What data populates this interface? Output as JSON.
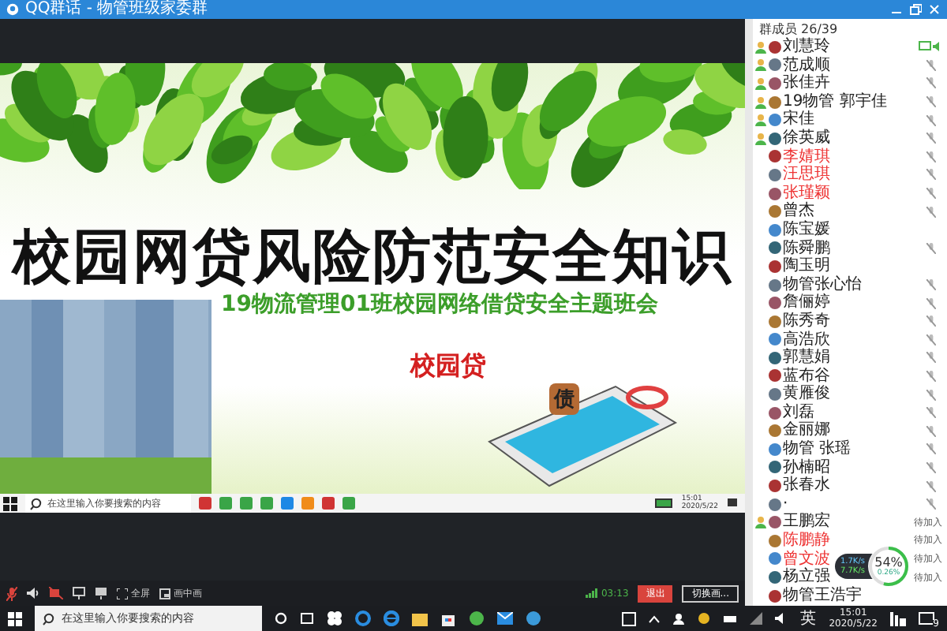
{
  "window": {
    "title": "QQ群话 - 物管班级家委群"
  },
  "slide": {
    "title": "校园网贷风险防范安全知识",
    "subtitle": "19物流管理01班校园网络借贷安全主题班会",
    "tag": "校园贷",
    "sign": "债"
  },
  "inner_taskbar": {
    "search_placeholder": "在这里输入你要搜索的内容",
    "time": "15:01",
    "date": "2020/5/22"
  },
  "call_controls": {
    "fullscreen": "全屏",
    "pip": "画中画",
    "duration": "03:13",
    "exit": "退出",
    "switch": "切换画..."
  },
  "members": {
    "header": "群成员 26/39",
    "items": [
      {
        "name": "刘慧玲",
        "role_icon": true,
        "highlighted": false,
        "kind": "speaking"
      },
      {
        "name": "范成顺",
        "role_icon": true,
        "highlighted": false,
        "kind": "muted"
      },
      {
        "name": "张佳卉",
        "role_icon": true,
        "highlighted": false,
        "kind": "muted"
      },
      {
        "name": "19物管 郭宇佳",
        "role_icon": true,
        "highlighted": false,
        "kind": "muted"
      },
      {
        "name": "宋佳",
        "role_icon": true,
        "highlighted": false,
        "kind": "muted"
      },
      {
        "name": "徐英威",
        "role_icon": true,
        "highlighted": false,
        "kind": "muted"
      },
      {
        "name": "李婧琪",
        "role_icon": false,
        "highlighted": true,
        "kind": "muted"
      },
      {
        "name": "汪思琪",
        "role_icon": false,
        "highlighted": true,
        "kind": "muted"
      },
      {
        "name": "张瑾颖",
        "role_icon": false,
        "highlighted": true,
        "kind": "muted"
      },
      {
        "name": "曾杰",
        "role_icon": false,
        "highlighted": false,
        "kind": "muted"
      },
      {
        "name": "陈宝媛",
        "role_icon": false,
        "highlighted": false,
        "kind": "none"
      },
      {
        "name": "陈舜鹏",
        "role_icon": false,
        "highlighted": false,
        "kind": "muted"
      },
      {
        "name": "陶玉明",
        "role_icon": false,
        "highlighted": false,
        "kind": "none"
      },
      {
        "name": "物管张心怡",
        "role_icon": false,
        "highlighted": false,
        "kind": "muted"
      },
      {
        "name": "詹俪婷",
        "role_icon": false,
        "highlighted": false,
        "kind": "muted"
      },
      {
        "name": "陈秀奇",
        "role_icon": false,
        "highlighted": false,
        "kind": "muted"
      },
      {
        "name": "高浩欣",
        "role_icon": false,
        "highlighted": false,
        "kind": "muted"
      },
      {
        "name": "郭慧娟",
        "role_icon": false,
        "highlighted": false,
        "kind": "muted"
      },
      {
        "name": "蓝布谷",
        "role_icon": false,
        "highlighted": false,
        "kind": "muted"
      },
      {
        "name": "黄雁俊",
        "role_icon": false,
        "highlighted": false,
        "kind": "muted"
      },
      {
        "name": "刘磊",
        "role_icon": false,
        "highlighted": false,
        "kind": "muted"
      },
      {
        "name": "金丽娜",
        "role_icon": false,
        "highlighted": false,
        "kind": "muted"
      },
      {
        "name": "物管 张瑶",
        "role_icon": false,
        "highlighted": false,
        "kind": "muted"
      },
      {
        "name": "孙楠昭",
        "role_icon": false,
        "highlighted": false,
        "kind": "muted"
      },
      {
        "name": "张春水",
        "role_icon": false,
        "highlighted": false,
        "kind": "muted"
      },
      {
        "name": "·",
        "role_icon": false,
        "highlighted": false,
        "kind": "muted"
      },
      {
        "name": "王鹏宏",
        "role_icon": true,
        "highlighted": false,
        "kind": "pending",
        "status_text": "待加入"
      },
      {
        "name": "陈鹏静",
        "role_icon": false,
        "highlighted": true,
        "kind": "pending",
        "status_text": "待加入"
      },
      {
        "name": "曾文波",
        "role_icon": false,
        "highlighted": true,
        "kind": "pending",
        "status_text": "待加入"
      },
      {
        "name": "杨立强",
        "role_icon": false,
        "highlighted": false,
        "kind": "pending",
        "status_text": "待加入"
      },
      {
        "name": "物管王浩宇",
        "role_icon": false,
        "highlighted": false,
        "kind": "none"
      }
    ]
  },
  "speed": {
    "up": "1.7K/s",
    "down": "7.7K/s",
    "percent": "54%",
    "sub": "0.26%",
    "level": 0.54
  },
  "taskbar": {
    "search_placeholder": "在这里输入你要搜索的内容",
    "ime": "英",
    "time": "15:01",
    "date": "2020/5/22",
    "notification_count": "9"
  }
}
